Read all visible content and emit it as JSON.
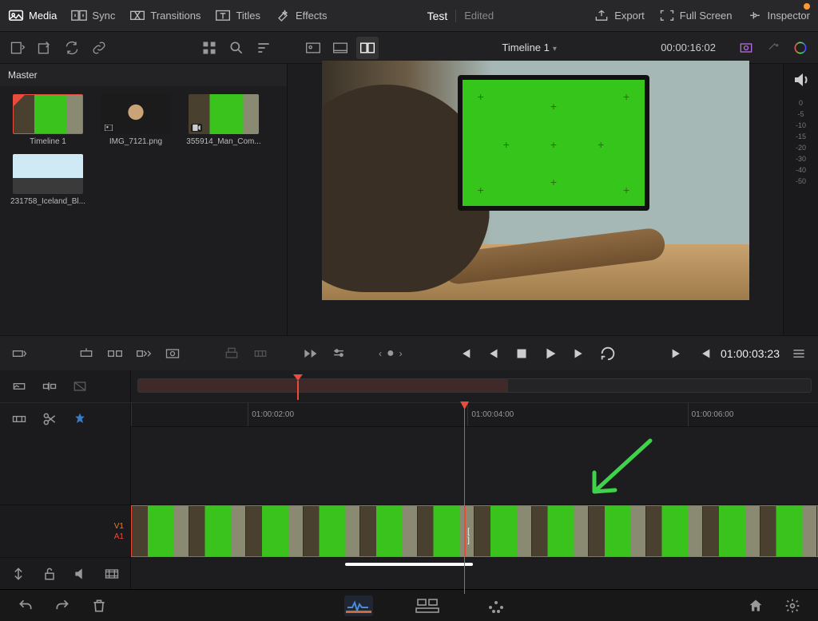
{
  "top": {
    "media": "Media",
    "sync": "Sync",
    "transitions": "Transitions",
    "titles": "Titles",
    "effects": "Effects",
    "export": "Export",
    "fullscreen": "Full Screen",
    "inspector": "Inspector",
    "project": "Test",
    "status": "Edited"
  },
  "viewer": {
    "timeline_name": "Timeline 1",
    "timecode": "00:00:16:02",
    "transport_timecode": "01:00:03:23"
  },
  "pool": {
    "bin": "Master",
    "clips": [
      {
        "label": "Timeline 1"
      },
      {
        "label": "IMG_7121.png"
      },
      {
        "label": "355914_Man_Com..."
      },
      {
        "label": "231758_Iceland_Bl..."
      }
    ]
  },
  "meter_ticks": [
    "0",
    "-5",
    "-10",
    "-15",
    "-20",
    "-30",
    "-40",
    "-50"
  ],
  "ruler": {
    "marks": [
      "01:00:02:00",
      "01:00:04:00",
      "01:00:06:00"
    ]
  },
  "tracks": {
    "v1": "V1",
    "a1": "A1"
  }
}
